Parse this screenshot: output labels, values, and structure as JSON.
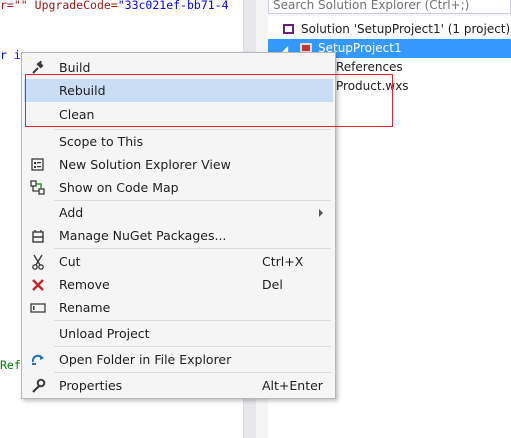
{
  "editor": {
    "line1_a": "r=\"\"",
    "line1_b": "UpgradeCode=",
    "line1_c": "\"33c021ef-bb71-4",
    "line2": "r in",
    "line3": "Ref"
  },
  "solution_explorer": {
    "search_placeholder": "Search Solution Explorer (Ctrl+;)",
    "solution_label": "Solution 'SetupProject1' (1 project)",
    "project_label": "SetupProject1",
    "references_label": "References",
    "file_label": "Product.wxs"
  },
  "context_menu": {
    "items": [
      {
        "label": "Build",
        "icon": "build-icon"
      },
      {
        "label": "Rebuild",
        "icon": ""
      },
      {
        "label": "Clean",
        "icon": ""
      },
      {
        "label": "Scope to This",
        "icon": ""
      },
      {
        "label": "New Solution Explorer View",
        "icon": "new-view-icon"
      },
      {
        "label": "Show on Code Map",
        "icon": "code-map-icon"
      },
      {
        "label": "Add",
        "icon": "",
        "submenu": true
      },
      {
        "label": "Manage NuGet Packages...",
        "icon": "nuget-icon"
      },
      {
        "label": "Cut",
        "icon": "scissors-icon",
        "shortcut": "Ctrl+X"
      },
      {
        "label": "Remove",
        "icon": "remove-x-icon",
        "shortcut": "Del"
      },
      {
        "label": "Rename",
        "icon": "rename-icon"
      },
      {
        "label": "Unload Project",
        "icon": ""
      },
      {
        "label": "Open Folder in File Explorer",
        "icon": "refresh-arrow-icon"
      },
      {
        "label": "Properties",
        "icon": "wrench-icon",
        "shortcut": "Alt+Enter"
      }
    ]
  },
  "colors": {
    "selection": "#3399ff",
    "menu_hover": "#c9def5",
    "annotation": "#e8222b"
  }
}
